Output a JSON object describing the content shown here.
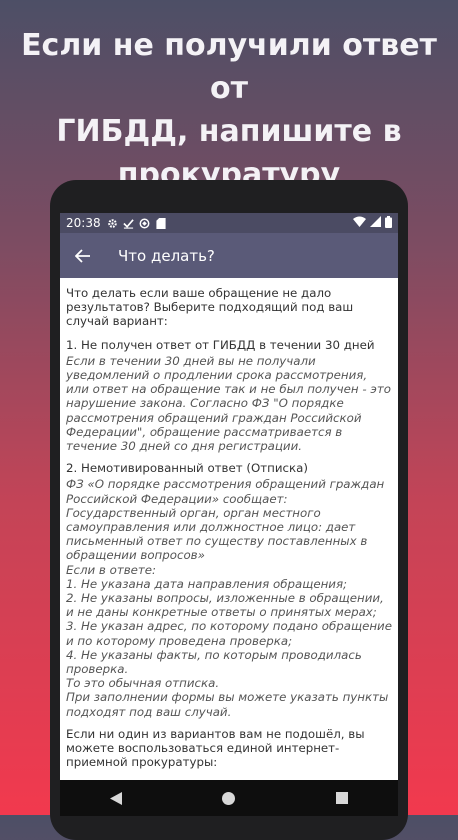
{
  "headline": {
    "line1": "Если не получили ответ от",
    "line2": "ГИБДД, напишите в",
    "line3": "прокуратуру"
  },
  "status_bar": {
    "time": "20:38",
    "left_icons": [
      "gear-icon",
      "check-icon",
      "sync-icon",
      "sd-card-icon"
    ],
    "right_icons": [
      "wifi-icon",
      "signal-icon",
      "battery-icon"
    ]
  },
  "app_bar": {
    "title": "Что делать?"
  },
  "content": {
    "intro": "Что делать если ваше обращение не дало результатов? Выберите подходящий под ваш случай вариант:",
    "section1": {
      "title": "1. Не получен ответ от ГИБДД в течении 30 дней",
      "body": "Если в течении 30 дней вы не получали уведомлений о продлении срока рассмотрения, или ответ на обращение так и не был получен - это нарушение закона. Согласно ФЗ \"О порядке рассмотрения обращений граждан Российской Федерации\", обращение рассматривается в течение 30 дней со дня регистрации."
    },
    "section2": {
      "title": "2. Немотивированный ответ (Отписка)",
      "p1": "ФЗ «О порядке рассмотрения обращений граждан Российской Федерации» сообщает: Государственный орган, орган местного самоуправления или должностное лицо: дает письменный ответ по существу поставленных в обращении вопросов»",
      "p2": "Если в ответе:",
      "items": [
        "1. Не указана дата направления обращения;",
        "2. Не указаны вопросы, изложенные в обращении, и не даны конкретные ответы о принятых мерах;",
        "3. Не указан адрес, по которому подано обращение и по которому проведена проверка;",
        "4. Не указаны факты, по которым проводилась проверка."
      ],
      "p3": "То это обычная отписка.",
      "p4": "При заполнении формы вы можете указать пункты подходят под ваш случай."
    },
    "outro": "Если ни один из вариантов вам не подошёл, вы можете воспользоваться единой интернет-приемной прокуратуры:"
  },
  "nav_bar": {
    "icons": [
      "back-triangle-icon",
      "home-circle-icon",
      "recents-square-icon"
    ]
  },
  "colors": {
    "status_bar": "#4b4b63",
    "app_bar": "#5a5a78",
    "background_top": "#4d4f66",
    "background_bottom": "#f2394e"
  }
}
